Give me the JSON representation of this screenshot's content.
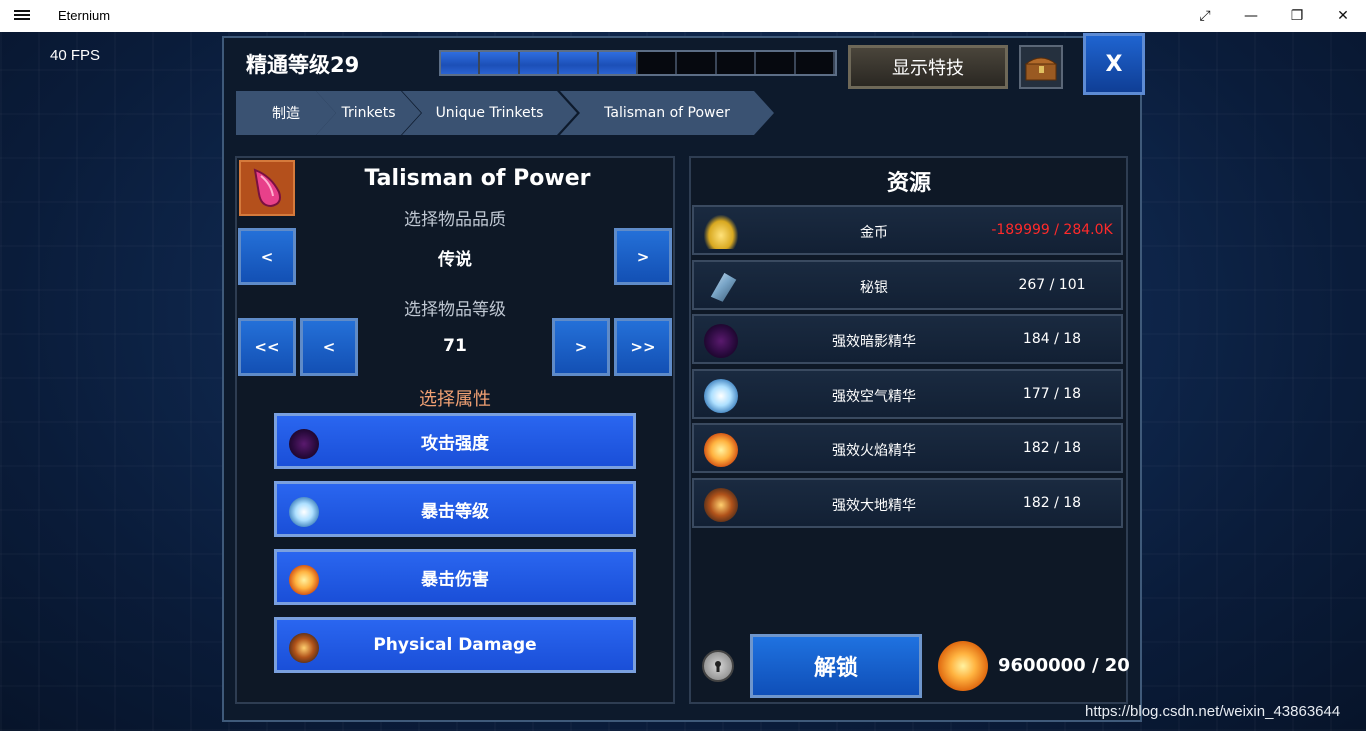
{
  "window": {
    "title": "Eternium"
  },
  "hud": {
    "fps": "40 FPS"
  },
  "header": {
    "mastery": "精通等级29",
    "xp_segments_filled": 5,
    "xp_segments_total": 10,
    "show_skills_label": "显示特技",
    "close_label": "X"
  },
  "breadcrumbs": [
    "制造",
    "Trinkets",
    "Unique Trinkets",
    "Talisman of Power"
  ],
  "item": {
    "name": "Talisman of Power",
    "quality_label": "选择物品品质",
    "quality_value": "传说",
    "level_label": "选择物品等级",
    "level_value": "71",
    "prev": "<",
    "next": ">",
    "prev_fast": "<<",
    "next_fast": ">>"
  },
  "attributes": {
    "title": "选择属性",
    "options": [
      "攻击强度",
      "暴击等级",
      "暴击伤害",
      "Physical Damage"
    ]
  },
  "resources": {
    "title": "资源",
    "rows": [
      {
        "name": "金币",
        "value": "-189999 / 284.0K",
        "icon": "gold-coins-icon",
        "negative": true
      },
      {
        "name": "秘银",
        "value": "267 / 101",
        "icon": "mithril-icon",
        "negative": false
      },
      {
        "name": "强效暗影精华",
        "value": "184 / 18",
        "icon": "shadow-essence-icon",
        "negative": false
      },
      {
        "name": "强效空气精华",
        "value": "177 / 18",
        "icon": "air-essence-icon",
        "negative": false
      },
      {
        "name": "强效火焰精华",
        "value": "182 / 18",
        "icon": "fire-essence-icon",
        "negative": false
      },
      {
        "name": "强效大地精华",
        "value": "182 / 18",
        "icon": "earth-essence-icon",
        "negative": false
      }
    ]
  },
  "unlock": {
    "label": "解锁",
    "cost": "9600000 / 20"
  },
  "watermark": "https://blog.csdn.net/weixin_43863644",
  "colors": {
    "accent_blue": "#2470d8",
    "negative_red": "#ff2a2a",
    "attr_title": "#f0a073"
  }
}
